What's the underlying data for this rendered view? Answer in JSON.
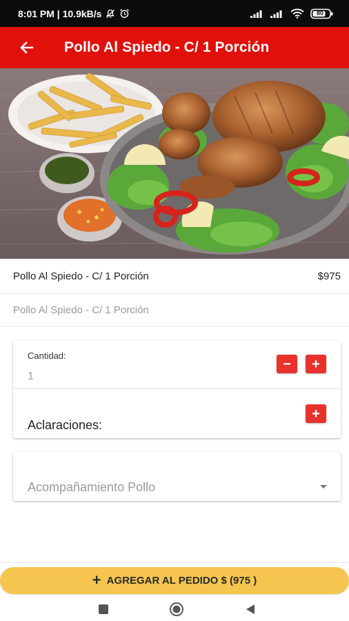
{
  "status_bar": {
    "time_info": "8:01 PM | 10.9kB/s",
    "battery": "80"
  },
  "app_bar": {
    "title": "Pollo Al Spiedo - C/ 1 Porción"
  },
  "product": {
    "name": "Pollo Al Spiedo - C/ 1 Porción",
    "price": "$975",
    "description": "Pollo Al Spiedo - C/ 1 Porción"
  },
  "quantity_card": {
    "label": "Cantidad:",
    "value": "1",
    "minus_label": "−",
    "plus_label": "+"
  },
  "notes_card": {
    "label": "Aclaraciones:",
    "add_label": "+"
  },
  "side_select": {
    "placeholder": "Acompañamiento Pollo"
  },
  "add_button": {
    "plus_icon": "+",
    "label": "AGREGAR AL PEDIDO $ (975 )"
  },
  "colors": {
    "status_bar": "#0c0c0c",
    "app_bar": "#e0100b",
    "accent_button": "#e8322d",
    "add_button": "#f6c54f"
  },
  "icons": {
    "back": "arrow-left-icon",
    "mute": "bell-off-icon",
    "alarm": "alarm-icon",
    "signal": "signal-icon",
    "wifi": "wifi-icon",
    "battery": "battery-icon",
    "dropdown": "caret-down-icon"
  }
}
